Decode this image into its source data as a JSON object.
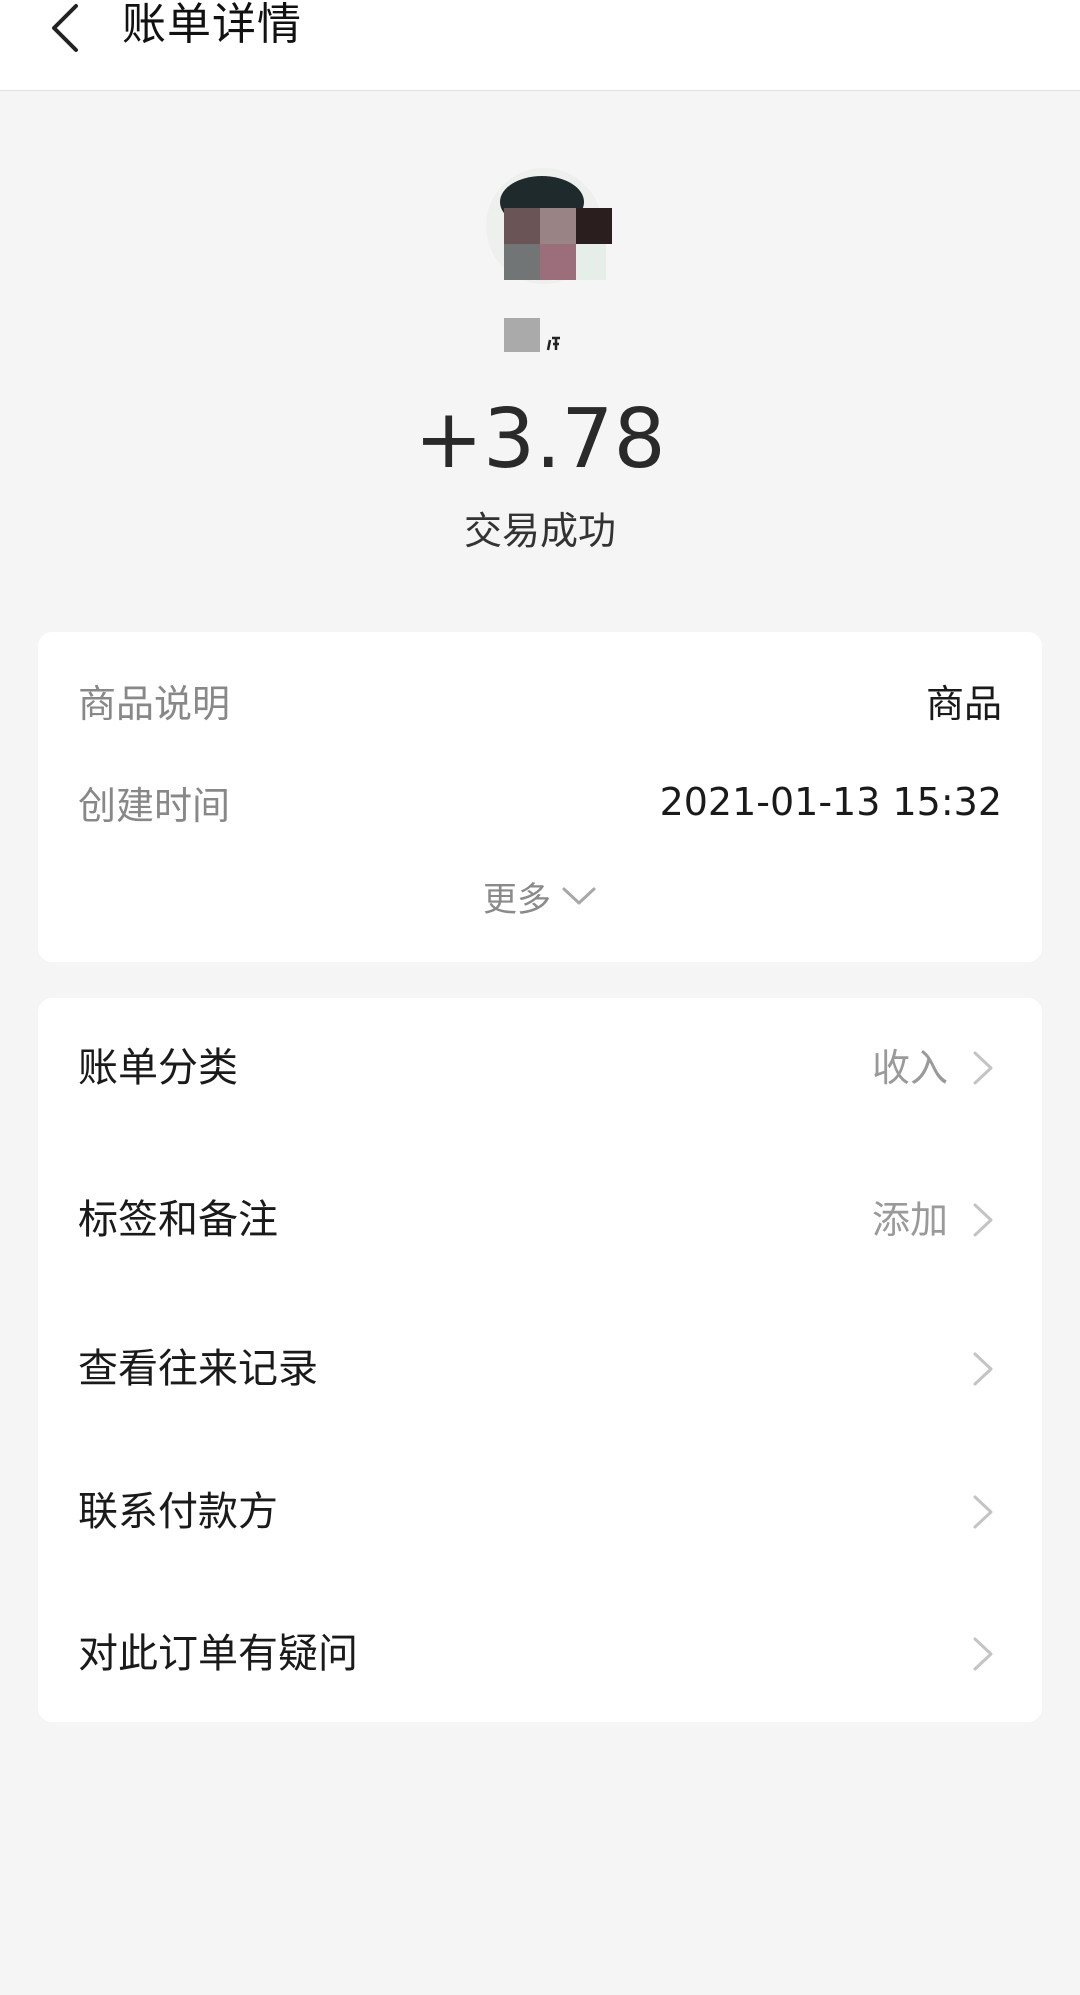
{
  "header": {
    "back_icon": "chevron-left-icon",
    "title": "账单详情"
  },
  "transaction": {
    "avatar_icon": "avatar-pixelated",
    "amount": "+3.78",
    "status": "交易成功"
  },
  "details": {
    "description_label": "商品说明",
    "description_value": "商品",
    "created_label": "创建时间",
    "created_value": "2021-01-13 15:32",
    "more_label": "更多",
    "more_icon": "chevron-down-icon"
  },
  "actions": [
    {
      "label": "账单分类",
      "value": "收入",
      "icon": "chevron-right-icon"
    },
    {
      "label": "标签和备注",
      "value": "添加",
      "icon": "chevron-right-icon"
    },
    {
      "label": "查看往来记录",
      "value": "",
      "icon": "chevron-right-icon"
    },
    {
      "label": "联系付款方",
      "value": "",
      "icon": "chevron-right-icon"
    },
    {
      "label": "对此订单有疑问",
      "value": "",
      "icon": "chevron-right-icon"
    }
  ],
  "colors": {
    "background": "#f5f5f5",
    "card": "#ffffff",
    "label_gray": "#888888",
    "chevron_gray": "#c4c4c4"
  }
}
